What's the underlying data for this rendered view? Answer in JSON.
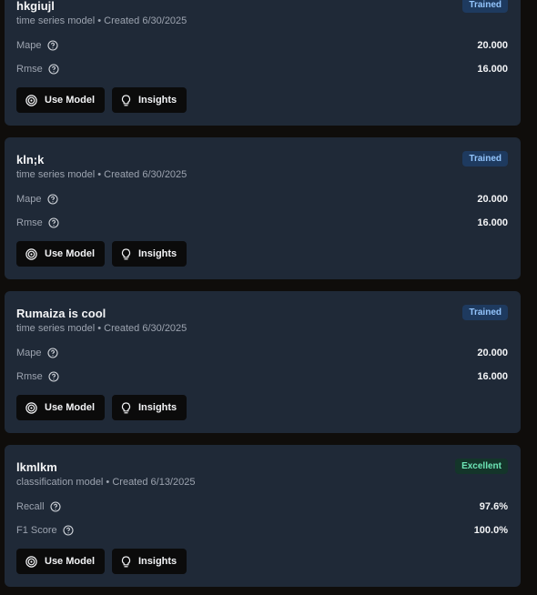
{
  "models": [
    {
      "name": "hkgiujl",
      "subtitle": "time series model • Created 6/30/2025",
      "badge": "Trained",
      "badge_type": "trained",
      "metrics": [
        {
          "label": "Mape",
          "value": "20.000"
        },
        {
          "label": "Rmse",
          "value": "16.000"
        }
      ]
    },
    {
      "name": "kln;k",
      "subtitle": "time series model • Created 6/30/2025",
      "badge": "Trained",
      "badge_type": "trained",
      "metrics": [
        {
          "label": "Mape",
          "value": "20.000"
        },
        {
          "label": "Rmse",
          "value": "16.000"
        }
      ]
    },
    {
      "name": "Rumaiza is cool",
      "subtitle": "time series model • Created 6/30/2025",
      "badge": "Trained",
      "badge_type": "trained",
      "metrics": [
        {
          "label": "Mape",
          "value": "20.000"
        },
        {
          "label": "Rmse",
          "value": "16.000"
        }
      ]
    },
    {
      "name": "lkmlkm",
      "subtitle": "classification model • Created 6/13/2025",
      "badge": "Excellent",
      "badge_type": "excellent",
      "metrics": [
        {
          "label": "Recall",
          "value": "97.6%"
        },
        {
          "label": "F1 Score",
          "value": "100.0%"
        }
      ]
    }
  ],
  "buttons": {
    "use_model": "Use Model",
    "insights": "Insights"
  },
  "icons": {
    "use_model": "target-icon",
    "insights": "lightbulb-icon",
    "metric_help": "help-circle-icon"
  },
  "colors": {
    "card_bg": "#1f2937",
    "page_bg": "#0f0d0b",
    "trained_badge": "#93c5fd",
    "excellent_badge": "#6ee7b7"
  }
}
